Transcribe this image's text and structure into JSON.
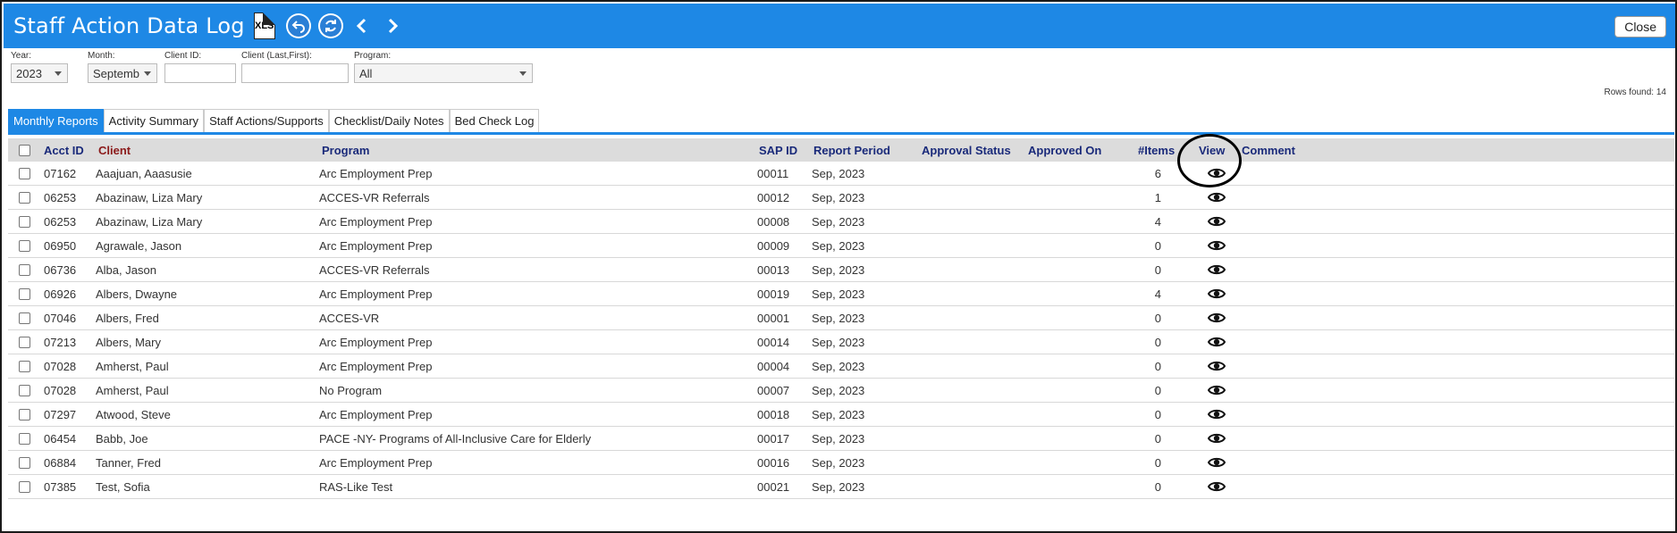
{
  "header": {
    "title": "Staff Action Data Log",
    "xls_label": "XLS",
    "close_label": "Close",
    "icons": [
      "excel-export-icon",
      "undo-icon",
      "refresh-icon",
      "previous-icon",
      "next-icon"
    ]
  },
  "filters": {
    "year": {
      "label": "Year:",
      "value": "2023"
    },
    "month": {
      "label": "Month:",
      "value": "Septemb"
    },
    "client_id": {
      "label": "Client ID:",
      "value": ""
    },
    "client_name": {
      "label": "Client (Last,First):",
      "value": ""
    },
    "program": {
      "label": "Program:",
      "value": "All"
    }
  },
  "rows_found": "Rows found: 14",
  "tabs": [
    {
      "label": "Monthly Reports",
      "active": true
    },
    {
      "label": "Activity Summary",
      "active": false
    },
    {
      "label": "Staff Actions/Supports",
      "active": false
    },
    {
      "label": "Checklist/Daily Notes",
      "active": false
    },
    {
      "label": "Bed Check Log",
      "active": false
    }
  ],
  "table": {
    "columns": {
      "acct_id": "Acct ID",
      "client": "Client",
      "program": "Program",
      "sap_id": "SAP ID",
      "report_period": "Report Period",
      "approval_status": "Approval Status",
      "approved_on": "Approved On",
      "items": "#Items",
      "view": "View",
      "comment": "Comment"
    },
    "rows": [
      {
        "acct_id": "07162",
        "client": "Aaajuan, Aaasusie",
        "program": "Arc Employment Prep",
        "sap_id": "00011",
        "report_period": "Sep, 2023",
        "items": "6"
      },
      {
        "acct_id": "06253",
        "client": "Abazinaw, Liza Mary",
        "program": "ACCES-VR Referrals",
        "sap_id": "00012",
        "report_period": "Sep, 2023",
        "items": "1"
      },
      {
        "acct_id": "06253",
        "client": "Abazinaw, Liza Mary",
        "program": "Arc Employment Prep",
        "sap_id": "00008",
        "report_period": "Sep, 2023",
        "items": "4"
      },
      {
        "acct_id": "06950",
        "client": "Agrawale, Jason",
        "program": "Arc Employment Prep",
        "sap_id": "00009",
        "report_period": "Sep, 2023",
        "items": "0"
      },
      {
        "acct_id": "06736",
        "client": "Alba, Jason",
        "program": "ACCES-VR Referrals",
        "sap_id": "00013",
        "report_period": "Sep, 2023",
        "items": "0"
      },
      {
        "acct_id": "06926",
        "client": "Albers, Dwayne",
        "program": "Arc Employment Prep",
        "sap_id": "00019",
        "report_period": "Sep, 2023",
        "items": "4"
      },
      {
        "acct_id": "07046",
        "client": "Albers, Fred",
        "program": "ACCES-VR",
        "sap_id": "00001",
        "report_period": "Sep, 2023",
        "items": "0"
      },
      {
        "acct_id": "07213",
        "client": "Albers, Mary",
        "program": "Arc Employment Prep",
        "sap_id": "00014",
        "report_period": "Sep, 2023",
        "items": "0"
      },
      {
        "acct_id": "07028",
        "client": "Amherst, Paul",
        "program": "Arc Employment Prep",
        "sap_id": "00004",
        "report_period": "Sep, 2023",
        "items": "0"
      },
      {
        "acct_id": "07028",
        "client": "Amherst, Paul",
        "program": "No Program",
        "sap_id": "00007",
        "report_period": "Sep, 2023",
        "items": "0"
      },
      {
        "acct_id": "07297",
        "client": "Atwood, Steve",
        "program": "Arc Employment Prep",
        "sap_id": "00018",
        "report_period": "Sep, 2023",
        "items": "0"
      },
      {
        "acct_id": "06454",
        "client": "Babb, Joe",
        "program": "PACE -NY- Programs of All-Inclusive Care for Elderly",
        "sap_id": "00017",
        "report_period": "Sep, 2023",
        "items": "0"
      },
      {
        "acct_id": "06884",
        "client": "Tanner, Fred",
        "program": "Arc Employment Prep",
        "sap_id": "00016",
        "report_period": "Sep, 2023",
        "items": "0"
      },
      {
        "acct_id": "07385",
        "client": "Test, Sofia",
        "program": "RAS-Like Test",
        "sap_id": "00021",
        "report_period": "Sep, 2023",
        "items": "0"
      }
    ]
  },
  "colors": {
    "header_blue": "#1e88e5",
    "column_header_text": "#1a2a7a",
    "client_header_text": "#8b1a1a",
    "table_header_bg": "#dcdcdc"
  }
}
